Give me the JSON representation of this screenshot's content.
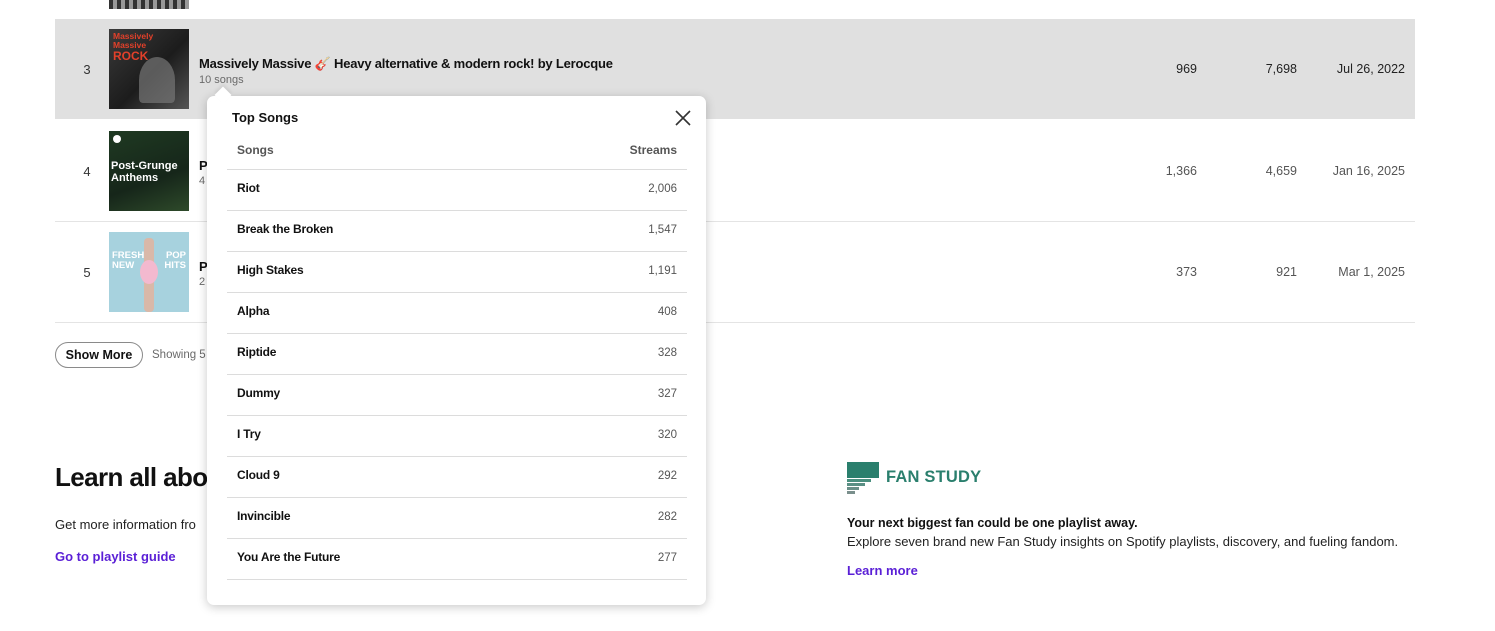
{
  "rows": [
    {
      "rank": "3",
      "title": "Massively Massive 🎸 Heavy alternative & modern rock! by Lerocque",
      "subtitle": "10 songs",
      "listeners": "969",
      "streams": "7,698",
      "date": "Jul 26, 2022",
      "cover_text": [
        "Massively",
        "Massive",
        "ROCK"
      ]
    },
    {
      "rank": "4",
      "title": "P",
      "subtitle": "4",
      "listeners": "1,366",
      "streams": "4,659",
      "date": "Jan 16, 2025",
      "cover_text": [
        "Post-Grunge",
        "Anthems"
      ]
    },
    {
      "rank": "5",
      "title": "P",
      "subtitle": "2",
      "listeners": "373",
      "streams": "921",
      "date": "Mar 1, 2025",
      "cover_text": [
        "FRESH",
        "NEW",
        "POP",
        "HITS"
      ]
    }
  ],
  "show_more_label": "Show More",
  "showing_text": "Showing 5",
  "learn": {
    "title": "Learn all abou",
    "desc": "Get more information fro",
    "link": "Go to playlist guide"
  },
  "fan_study": {
    "logo_text": "FAN STUDY",
    "headline": "Your next biggest fan could be one playlist away.",
    "desc": "Explore seven brand new Fan Study insights on Spotify playlists, discovery, and fueling fandom.",
    "link": "Learn more",
    "color": "#2a7f6d"
  },
  "popover": {
    "title": "Top Songs",
    "col_songs": "Songs",
    "col_streams": "Streams",
    "close_icon": "close-icon",
    "songs": [
      {
        "name": "Riot",
        "streams": "2,006"
      },
      {
        "name": "Break the Broken",
        "streams": "1,547"
      },
      {
        "name": "High Stakes",
        "streams": "1,191"
      },
      {
        "name": "Alpha",
        "streams": "408"
      },
      {
        "name": "Riptide",
        "streams": "328"
      },
      {
        "name": "Dummy",
        "streams": "327"
      },
      {
        "name": "I Try",
        "streams": "320"
      },
      {
        "name": "Cloud 9",
        "streams": "292"
      },
      {
        "name": "Invincible",
        "streams": "282"
      },
      {
        "name": "You Are the Future",
        "streams": "277"
      }
    ]
  },
  "colors": {
    "link": "#5a1fd6",
    "row_highlight": "#e0e0e0"
  }
}
